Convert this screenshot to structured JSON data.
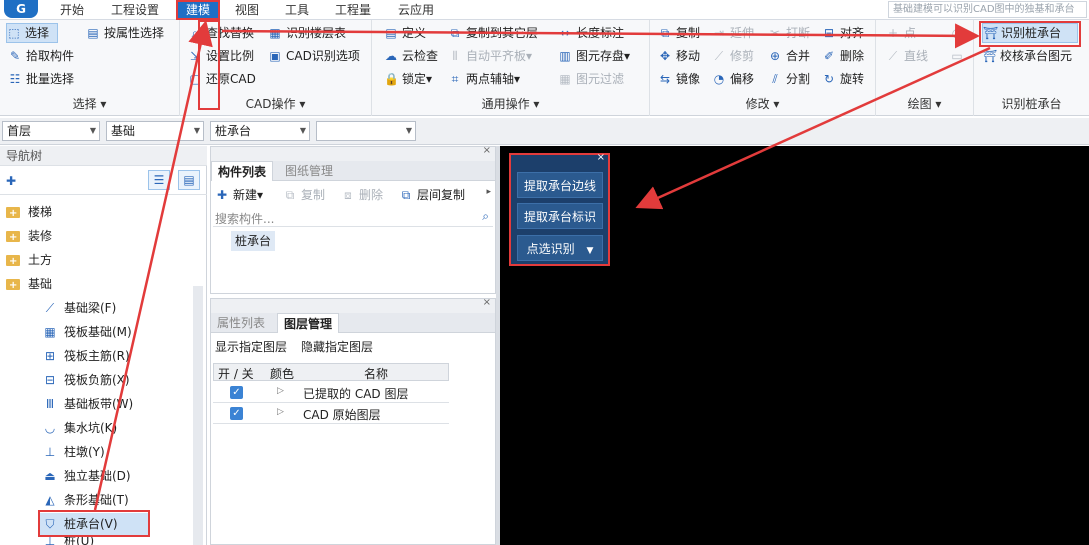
{
  "menu": {
    "logo": "G",
    "items": [
      "开始",
      "工程设置",
      "建模",
      "视图",
      "工具",
      "工程量",
      "云应用"
    ],
    "hint": "基础建模可以识别CAD图中的独基和承台"
  },
  "ribbon": {
    "select": {
      "label": "选择",
      "items": [
        "选择",
        "按属性选择",
        "拾取构件",
        "批量选择"
      ]
    },
    "cad": {
      "label": "CAD操作",
      "items": [
        "查找替换",
        "识别楼层表",
        "设置比例",
        "CAD识别选项",
        "还原CAD"
      ]
    },
    "common": {
      "label": "通用操作",
      "items": [
        "定义",
        "复制到其它层",
        "长度标注",
        "云检查",
        "自动平齐板",
        "图元存盘",
        "锁定",
        "两点辅轴",
        "图元过滤"
      ]
    },
    "modify": {
      "label": "修改",
      "items": [
        "复制",
        "延伸",
        "打断",
        "对齐",
        "移动",
        "修剪",
        "合并",
        "删除",
        "镜像",
        "偏移",
        "分割",
        "旋转"
      ]
    },
    "draw": {
      "label": "绘图",
      "items": [
        "点",
        "直线"
      ]
    },
    "identify": {
      "label": "识别桩承台",
      "items": [
        "识别桩承台",
        "校核承台图元"
      ]
    }
  },
  "combos": [
    "首层",
    "基础",
    "桩承台",
    ""
  ],
  "nav": {
    "title": "导航树",
    "folders": [
      "楼梯",
      "装修",
      "土方",
      "基础"
    ],
    "items": [
      "基础梁(F)",
      "筏板基础(M)",
      "筏板主筋(R)",
      "筏板负筋(X)",
      "基础板带(W)",
      "集水坑(K)",
      "柱墩(Y)",
      "独立基础(D)",
      "条形基础(T)",
      "桩承台(V)",
      "桩(U)"
    ]
  },
  "component_panel": {
    "tabs": [
      "构件列表",
      "图纸管理"
    ],
    "toolbar": [
      "新建",
      "复制",
      "删除",
      "层间复制"
    ],
    "search_placeholder": "搜索构件...",
    "items": [
      "桩承台"
    ]
  },
  "layer_panel": {
    "tabs": [
      "属性列表",
      "图层管理"
    ],
    "actions": [
      "显示指定图层",
      "隐藏指定图层"
    ],
    "headers": [
      "开 / 关",
      "颜色",
      "名称"
    ],
    "rows": [
      "已提取的 CAD 图层",
      "CAD 原始图层"
    ]
  },
  "popup": {
    "buttons": [
      "提取承台边线",
      "提取承台标识",
      "点选识别"
    ]
  }
}
